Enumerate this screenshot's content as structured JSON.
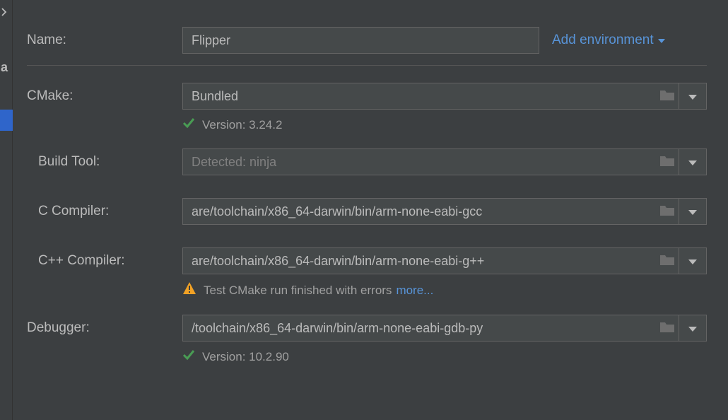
{
  "labels": {
    "name": "Name:",
    "cmake": "CMake:",
    "build_tool": "Build Tool:",
    "c_compiler": "C Compiler:",
    "cpp_compiler": "C++ Compiler:",
    "debugger": "Debugger:"
  },
  "fields": {
    "name_value": "Flipper",
    "cmake_value": "Bundled",
    "build_tool_placeholder": "Detected: ninja",
    "c_compiler_value": "are/toolchain/x86_64-darwin/bin/arm-none-eabi-gcc",
    "cpp_compiler_value": "are/toolchain/x86_64-darwin/bin/arm-none-eabi-g++",
    "debugger_value": "/toolchain/x86_64-darwin/bin/arm-none-eabi-gdb-py"
  },
  "status": {
    "cmake_version": "Version: 3.24.2",
    "compiler_error": "Test CMake run finished with errors",
    "more_label": "more...",
    "debugger_version": "Version: 10.2.90"
  },
  "actions": {
    "add_environment": "Add environment"
  },
  "sidebar": {
    "letter": "a"
  }
}
